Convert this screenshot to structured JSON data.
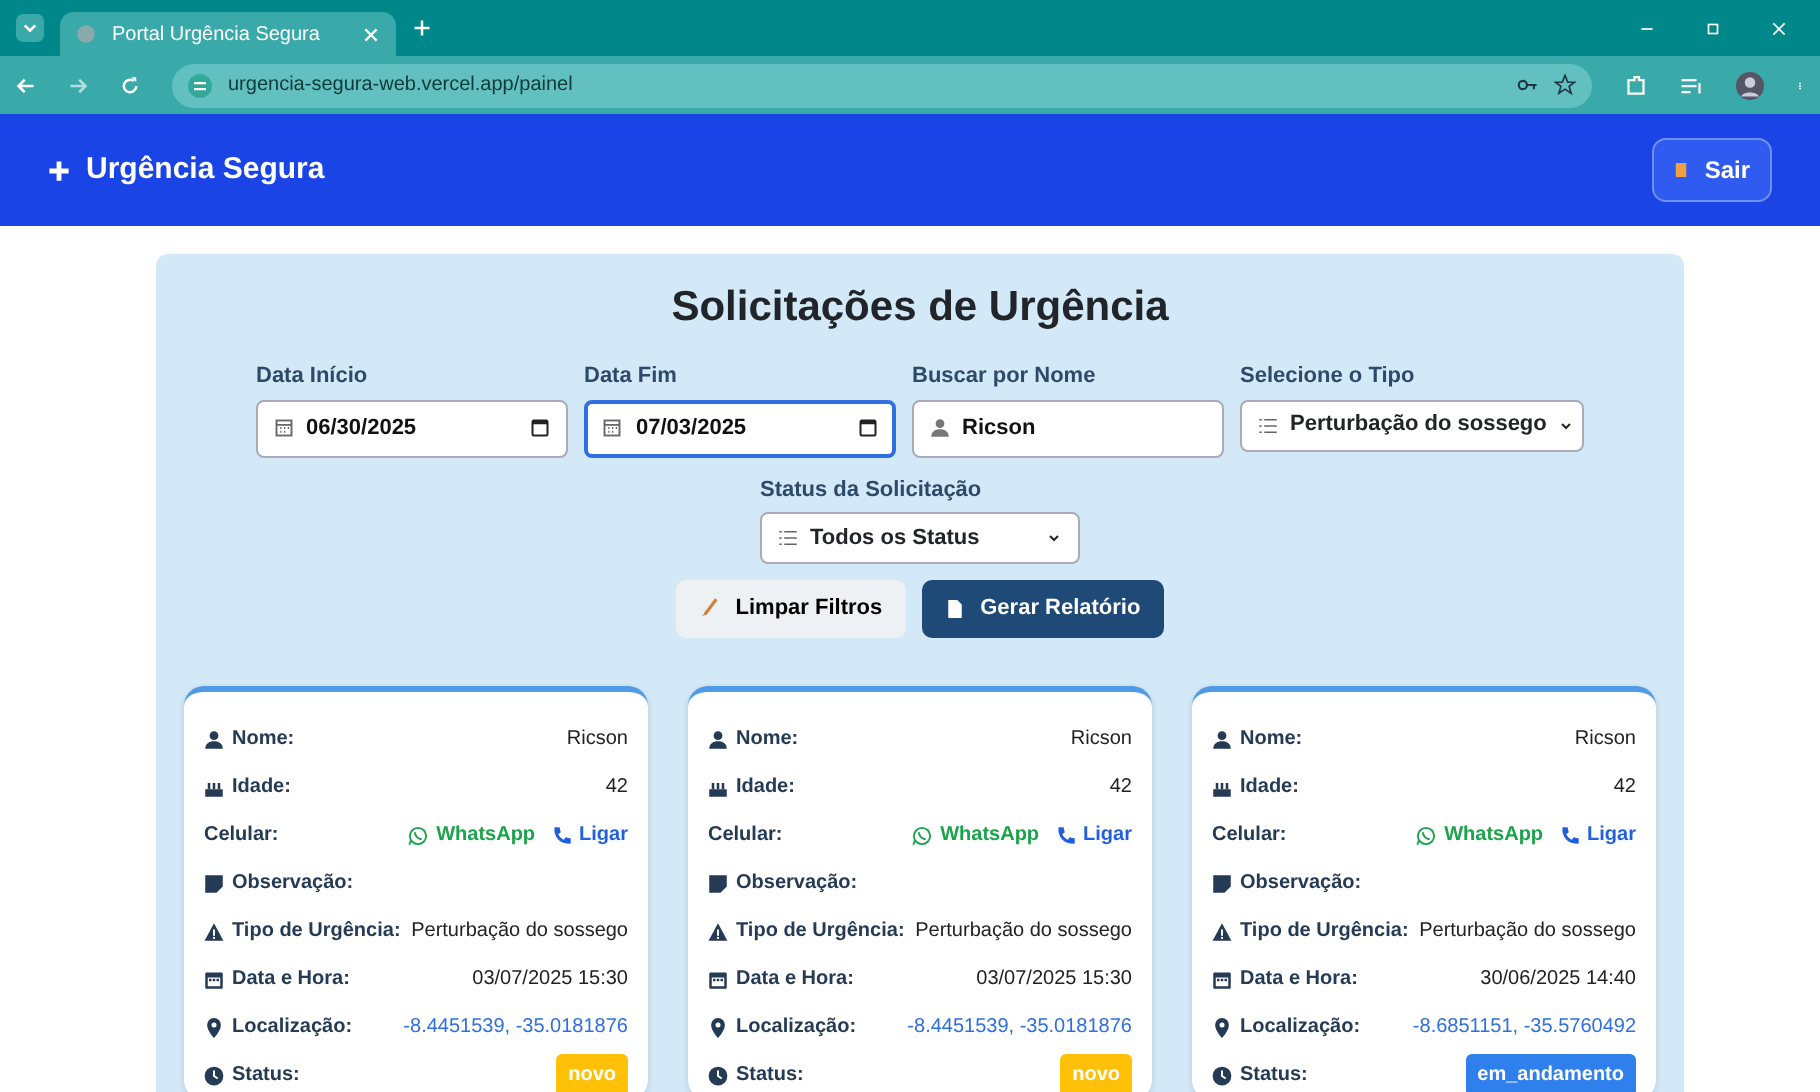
{
  "browser": {
    "tab_title": "Portal Urgência Segura",
    "url": "urgencia-segura-web.vercel.app/painel"
  },
  "navbar": {
    "brand": "Urgência Segura",
    "logout": "Sair"
  },
  "panel": {
    "title": "Solicitações de Urgência",
    "filters": [
      {
        "kind": "date",
        "label": "Data Início",
        "value": "06/30/2025",
        "focused": false
      },
      {
        "kind": "date",
        "label": "Data Fim",
        "value": "07/03/2025",
        "focused": true
      },
      {
        "kind": "text",
        "label": "Buscar por Nome",
        "value": "Ricson",
        "focused": false
      },
      {
        "kind": "select",
        "label": "Selecione o Tipo",
        "value": "Perturbação do sossego",
        "focused": false
      }
    ],
    "status_filter": {
      "label": "Status da Solicitação",
      "value": "Todos os Status"
    },
    "buttons": [
      {
        "kind": "clear",
        "label": "Limpar Filtros"
      },
      {
        "kind": "report",
        "label": "Gerar Relatório"
      }
    ]
  },
  "cards": [
    {
      "rows": [
        {
          "kind": "name",
          "label": "Nome:",
          "value": "Ricson"
        },
        {
          "kind": "age",
          "label": "Idade:",
          "value": "42"
        },
        {
          "kind": "phone",
          "label": "Celular:",
          "whatsapp": "WhatsApp",
          "call": "Ligar"
        },
        {
          "kind": "note",
          "label": "Observação:"
        },
        {
          "kind": "type",
          "label": "Tipo de Urgência:",
          "value": "Perturbação do sossego"
        },
        {
          "kind": "datetime",
          "label": "Data e Hora:",
          "value": "03/07/2025 15:30"
        },
        {
          "kind": "location",
          "label": "Localização:",
          "value": "-8.4451539, -35.0181876"
        },
        {
          "kind": "status",
          "label": "Status:",
          "value": "novo",
          "color": "#ffc107"
        }
      ]
    },
    {
      "rows": [
        {
          "kind": "name",
          "label": "Nome:",
          "value": "Ricson"
        },
        {
          "kind": "age",
          "label": "Idade:",
          "value": "42"
        },
        {
          "kind": "phone",
          "label": "Celular:",
          "whatsapp": "WhatsApp",
          "call": "Ligar"
        },
        {
          "kind": "note",
          "label": "Observação:"
        },
        {
          "kind": "type",
          "label": "Tipo de Urgência:",
          "value": "Perturbação do sossego"
        },
        {
          "kind": "datetime",
          "label": "Data e Hora:",
          "value": "03/07/2025 15:30"
        },
        {
          "kind": "location",
          "label": "Localização:",
          "value": "-8.4451539, -35.0181876"
        },
        {
          "kind": "status",
          "label": "Status:",
          "value": "novo",
          "color": "#ffc107"
        }
      ]
    },
    {
      "rows": [
        {
          "kind": "name",
          "label": "Nome:",
          "value": "Ricson"
        },
        {
          "kind": "age",
          "label": "Idade:",
          "value": "42"
        },
        {
          "kind": "phone",
          "label": "Celular:",
          "whatsapp": "WhatsApp",
          "call": "Ligar"
        },
        {
          "kind": "note",
          "label": "Observação:"
        },
        {
          "kind": "type",
          "label": "Tipo de Urgência:",
          "value": "Perturbação do sossego"
        },
        {
          "kind": "datetime",
          "label": "Data e Hora:",
          "value": "30/06/2025 14:40"
        },
        {
          "kind": "location",
          "label": "Localização:",
          "value": "-8.6851151, -35.5760492"
        },
        {
          "kind": "status",
          "label": "Status:",
          "value": "em_andamento",
          "color": "#2f80ed"
        }
      ]
    }
  ]
}
